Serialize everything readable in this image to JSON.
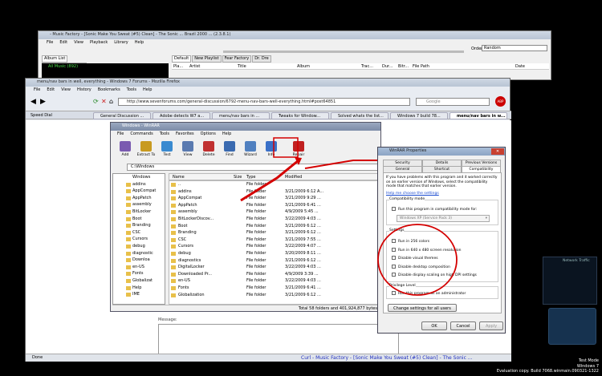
{
  "music_app": {
    "title": "- Music Factory - [Sonic Make You Sweat (#5) Clean] - The Sonic ... Brazil 2000 ... (2.3.8.1)",
    "menu": [
      "File",
      "Edit",
      "View",
      "Playback",
      "Library",
      "Help"
    ],
    "order_label": "Order:",
    "order_value": "Random",
    "left_tabs": [
      "Album List",
      "Selection Properties"
    ],
    "all_music": "All Music (892)",
    "playlist_tabs": [
      "Default",
      "New Playlist",
      "Fear Factory",
      "Dr. Dre"
    ],
    "columns": [
      "Pla...",
      "Artist",
      "Title",
      "Album",
      "Trac...",
      "Dur...",
      "Bitr...",
      "File Path",
      "Date"
    ]
  },
  "firefox": {
    "title": "menu/nav bars in well, everything - Windows 7 Forums - Mozilla Firefox",
    "menu": [
      "File",
      "Edit",
      "View",
      "History",
      "Bookmarks",
      "Tools",
      "Help"
    ],
    "url": "http://www.sevenforums.com/general-discussion/6792-menu-nav-bars-well-everything.html#post64851",
    "search_placeholder": "Google",
    "speed_dial": "Speed Dial",
    "tabs": [
      "General Discussion ...",
      "Adobe detects W7 a...",
      "menu/nav bars in ...",
      "Tweaks for Window...",
      "Solved whats the list...",
      "Windows 7 build 78...",
      "menu/nav bars in w..."
    ],
    "status": "Done",
    "message_label": "Message:"
  },
  "winrar": {
    "title": "Windows - WinRAR",
    "menu": [
      "File",
      "Commands",
      "Tools",
      "Favorites",
      "Options",
      "Help"
    ],
    "toolbar": [
      "Add",
      "Extract To",
      "Test",
      "View",
      "Delete",
      "Find",
      "Wizard",
      "Info",
      "Repair"
    ],
    "path": "C:\\Windows",
    "tree_root": "Windows",
    "tree": [
      "addins",
      "AppCompat",
      "AppPatch",
      "assembly",
      "BitLocker",
      "Boot",
      "Branding",
      "CSC",
      "Cursors",
      "debug",
      "diagnostic",
      "Downloa",
      "en-US",
      "Fonts",
      "Globalizat",
      "Help",
      "IME"
    ],
    "columns": [
      "Name",
      "Size",
      "Type",
      "Modified"
    ],
    "files": [
      {
        "name": "..",
        "type": "File folder",
        "modified": ""
      },
      {
        "name": "addins",
        "type": "File folder",
        "modified": "3/21/2009 6:12 A..."
      },
      {
        "name": "AppCompat",
        "type": "File folder",
        "modified": "3/21/2009 9:29 ..."
      },
      {
        "name": "AppPatch",
        "type": "File folder",
        "modified": "3/21/2009 6:41 ..."
      },
      {
        "name": "assembly",
        "type": "File folder",
        "modified": "4/9/2009 5:45 ..."
      },
      {
        "name": "BitLockerDiscov...",
        "type": "File folder",
        "modified": "3/22/2009 4:03 ..."
      },
      {
        "name": "Boot",
        "type": "File folder",
        "modified": "3/21/2009 6:12 ..."
      },
      {
        "name": "Branding",
        "type": "File folder",
        "modified": "3/21/2009 6:12 ..."
      },
      {
        "name": "CSC",
        "type": "File folder",
        "modified": "3/21/2009 7:55 ..."
      },
      {
        "name": "Cursors",
        "type": "File folder",
        "modified": "3/22/2009 4:07 ..."
      },
      {
        "name": "debug",
        "type": "File folder",
        "modified": "3/20/2009 8:11 ..."
      },
      {
        "name": "diagnostics",
        "type": "File folder",
        "modified": "3/21/2009 6:12 ..."
      },
      {
        "name": "DigitalLocker",
        "type": "File folder",
        "modified": "3/22/2009 4:03 ..."
      },
      {
        "name": "Downloaded Pr...",
        "type": "File folder",
        "modified": "4/9/2009 3:39 ..."
      },
      {
        "name": "en-US",
        "type": "File folder",
        "modified": "3/22/2009 4:03 ..."
      },
      {
        "name": "Fonts",
        "type": "File folder",
        "modified": "3/21/2009 6:41 ..."
      },
      {
        "name": "Globalization",
        "type": "File folder",
        "modified": "3/21/2009 6:12 ..."
      }
    ],
    "status_total": "Total 58 folders and 401,924,877 bytes"
  },
  "properties": {
    "title": "WinRAR Properties",
    "tabs_row1": [
      "Security",
      "Details",
      "Previous Versions"
    ],
    "tabs_row2": [
      "General",
      "Shortcut",
      "Compatibility"
    ],
    "intro": "If you have problems with this program and it worked correctly on an earlier version of Windows, select the compatibility mode that matches that earlier version.",
    "help_link": "Help me choose the settings",
    "compat_group": "Compatibility mode",
    "compat_check": "Run this program in compatibility mode for:",
    "compat_select": "Windows XP (Service Pack 3)",
    "settings_group": "Settings",
    "settings": [
      "Run in 256 colors",
      "Run in 640 x 480 screen resolution",
      "Disable visual themes",
      "Disable desktop composition",
      "Disable display scaling on high DPI settings"
    ],
    "privilege_group": "Privilege Level",
    "privilege_check": "Run this program as an administrator",
    "change_all": "Change settings for all users",
    "ok": "OK",
    "cancel": "Cancel",
    "apply": "Apply"
  },
  "desktop": {
    "gadget_title": "Network Traffic",
    "watermark": [
      "Test Mode",
      "Windows 7",
      "Evaluation copy. Build 7068.winmain.090321-1322"
    ],
    "now_playing": "Curl - Music Factory - [Sonic Make You Sweat (#5) Clean] - The Sonic ..."
  },
  "colors": {
    "annotation_red": "#d40000",
    "link_blue": "#1a4bd0",
    "selection": "#316ac5"
  }
}
